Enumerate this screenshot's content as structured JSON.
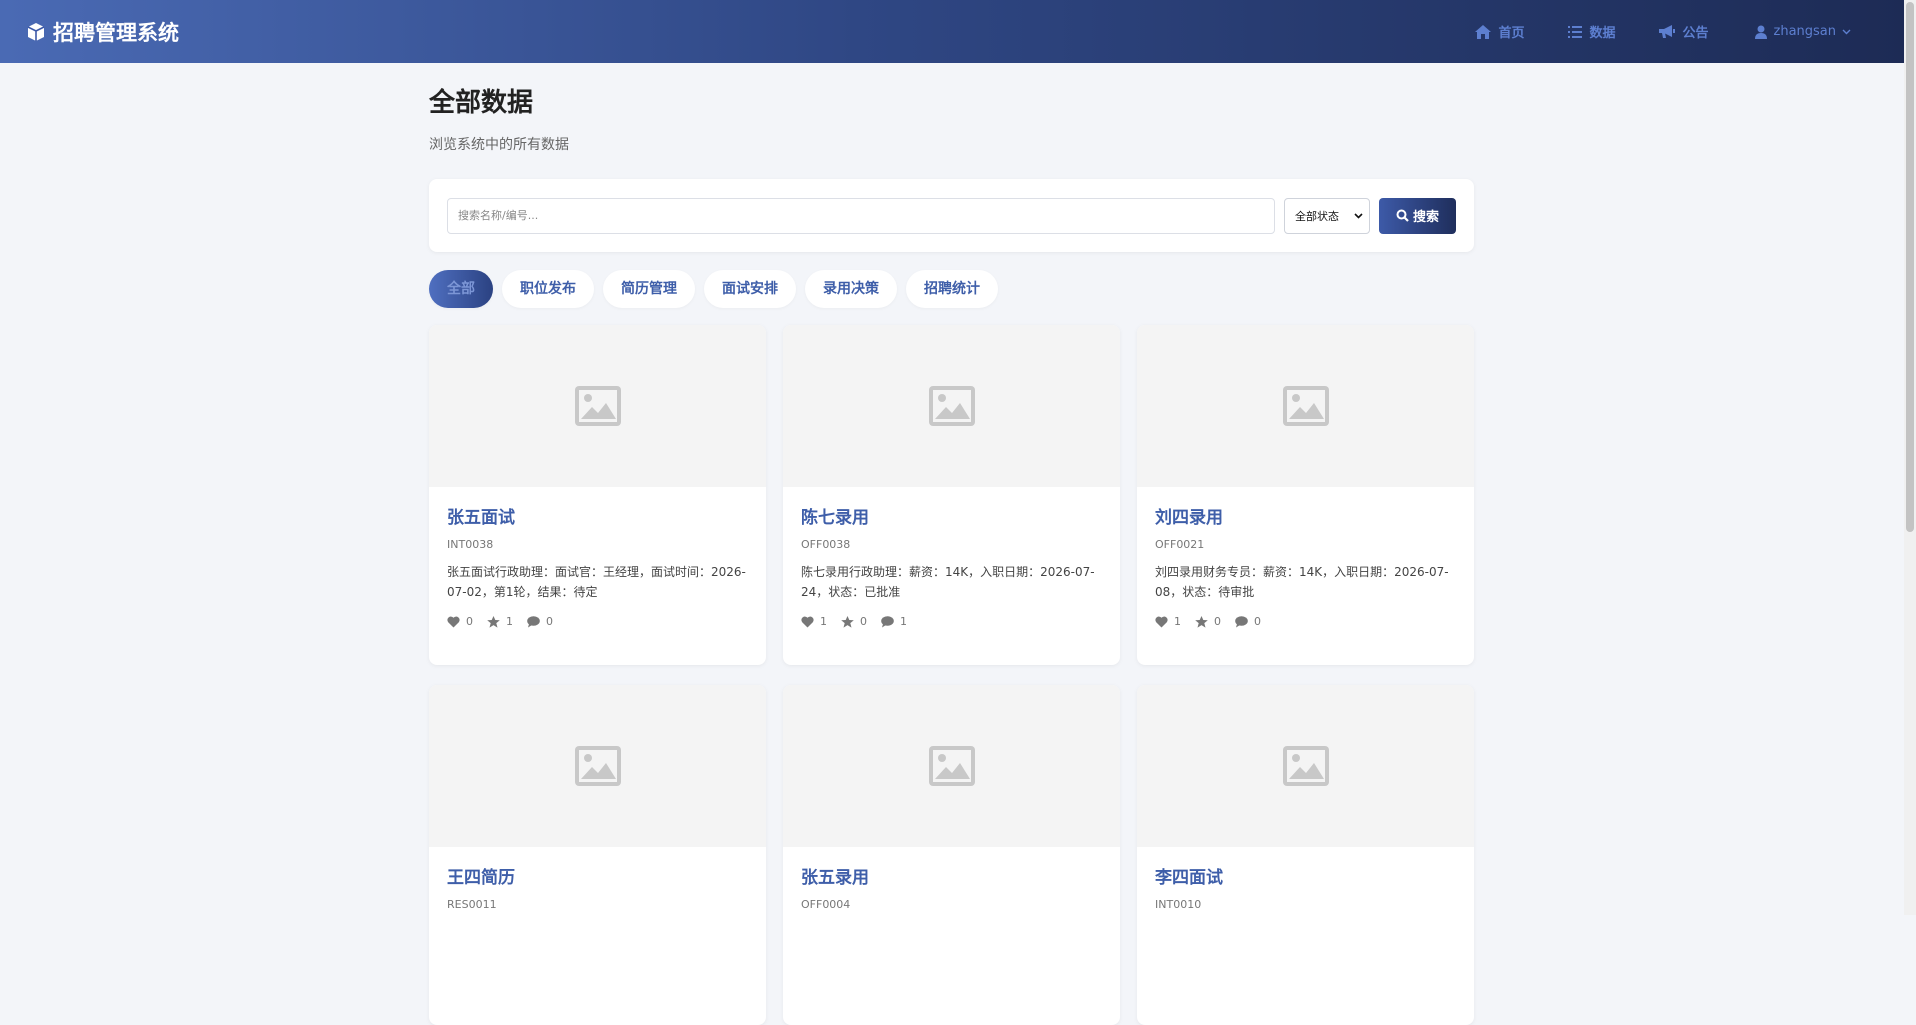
{
  "navbar": {
    "brand": "招聘管理系统",
    "links": [
      {
        "label": "首页",
        "icon": "home-icon"
      },
      {
        "label": "数据",
        "icon": "list-icon"
      },
      {
        "label": "公告",
        "icon": "megaphone-icon"
      }
    ],
    "user": "zhangsan"
  },
  "page": {
    "title": "全部数据",
    "subtitle": "浏览系统中的所有数据"
  },
  "search": {
    "placeholder": "搜索名称/编号...",
    "status_selected": "全部状态",
    "button_label": "搜索"
  },
  "tabs": [
    "全部",
    "职位发布",
    "简历管理",
    "面试安排",
    "录用决策",
    "招聘统计"
  ],
  "active_tab": "全部",
  "cards": [
    {
      "title": "张五面试",
      "code": "INT0038",
      "desc": "张五面试行政助理：面试官：王经理，面试时间：2026-07-02，第1轮，结果：待定",
      "likes": "0",
      "favorites": "1",
      "comments": "0"
    },
    {
      "title": "陈七录用",
      "code": "OFF0038",
      "desc": "陈七录用行政助理：薪资：14K，入职日期：2026-07-24，状态：已批准",
      "likes": "1",
      "favorites": "0",
      "comments": "1"
    },
    {
      "title": "刘四录用",
      "code": "OFF0021",
      "desc": "刘四录用财务专员：薪资：14K，入职日期：2026-07-08，状态：待审批",
      "likes": "1",
      "favorites": "0",
      "comments": "0"
    },
    {
      "title": "王四简历",
      "code": "RES0011"
    },
    {
      "title": "张五录用",
      "code": "OFF0004"
    },
    {
      "title": "李四面试",
      "code": "INT0010"
    }
  ],
  "colors": {
    "accent": "#3e5ea9",
    "navbar_start": "#4a6ab4",
    "navbar_end": "#1d2b55",
    "background": "#f3f5f9"
  }
}
